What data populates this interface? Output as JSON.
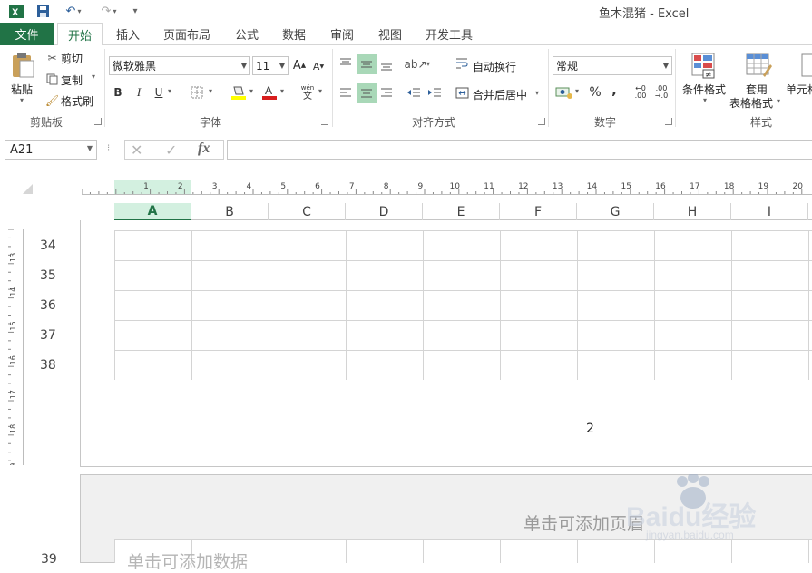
{
  "window": {
    "title": "鱼木混猪 - Excel"
  },
  "tabs": [
    {
      "label": "文件"
    },
    {
      "label": "开始"
    },
    {
      "label": "插入"
    },
    {
      "label": "页面布局"
    },
    {
      "label": "公式"
    },
    {
      "label": "数据"
    },
    {
      "label": "审阅"
    },
    {
      "label": "视图"
    },
    {
      "label": "开发工具"
    }
  ],
  "ribbon": {
    "clipboard": {
      "paste": "粘贴",
      "cut": "剪切",
      "copy": "复制",
      "format_painter": "格式刷",
      "group": "剪贴板"
    },
    "font": {
      "name": "微软雅黑",
      "size": "11",
      "bold": "B",
      "italic": "I",
      "underline": "U",
      "wen": "wén",
      "wen_char": "文",
      "group": "字体"
    },
    "alignment": {
      "wrap": "自动换行",
      "merge": "合并后居中",
      "group": "对齐方式"
    },
    "number": {
      "format": "常规",
      "percent": "%",
      "comma": ",",
      "group": "数字"
    },
    "styles": {
      "conditional": "条件格式",
      "table_format_1": "套用",
      "table_format_2": "表格格式",
      "cell_styles": "单元格",
      "group": "样式"
    }
  },
  "formula_bar": {
    "name_box": "A21",
    "fx": "fx",
    "value": ""
  },
  "ruler": {
    "h_ticks": [
      "1",
      "2",
      "3",
      "4",
      "5",
      "6",
      "7",
      "8",
      "9",
      "10",
      "11",
      "12",
      "13",
      "14",
      "15",
      "16",
      "17",
      "18",
      "19",
      "20"
    ],
    "v_ticks": [
      "13",
      "14",
      "15",
      "16",
      "17",
      "18",
      "9"
    ]
  },
  "columns": [
    "A",
    "B",
    "C",
    "D",
    "E",
    "F",
    "G",
    "H",
    "I"
  ],
  "selected_column": "A",
  "rows": [
    "34",
    "35",
    "36",
    "37",
    "38"
  ],
  "page_number": "2",
  "page2": {
    "header_placeholder": "单击可添加页眉",
    "data_placeholder": "单击可添加数据",
    "row_label": "39"
  },
  "watermark": {
    "text": "Baidu经验",
    "url": "jingyan.baidu.com"
  },
  "colors": {
    "accent": "#217346",
    "selection": "#a9d8b8"
  }
}
